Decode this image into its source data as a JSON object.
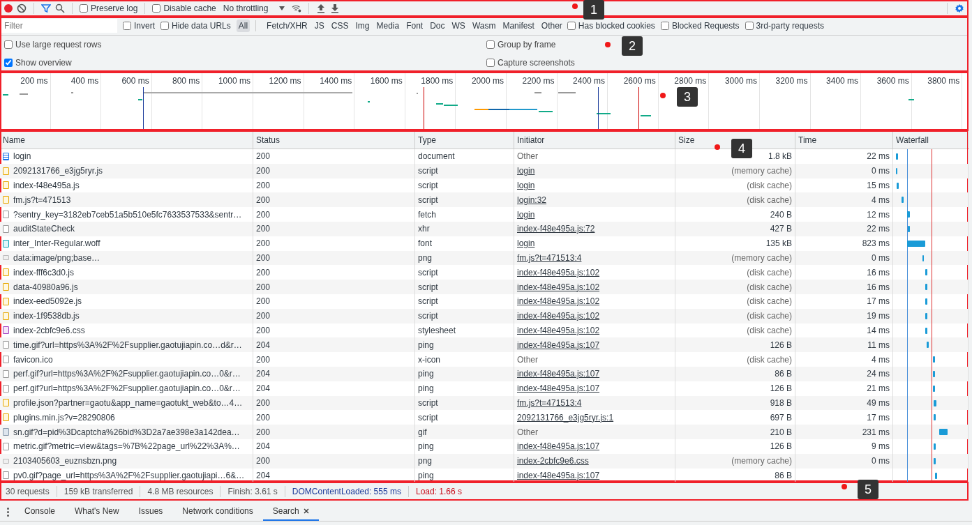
{
  "toolbar": {
    "preserve_log": {
      "label": "Preserve log",
      "checked": false
    },
    "disable_cache": {
      "label": "Disable cache",
      "checked": false
    },
    "throttling": "No throttling",
    "filter_active": true,
    "recording": true
  },
  "filter_bar": {
    "placeholder": "Filter",
    "checks_left": [
      {
        "label": "Invert",
        "checked": false
      },
      {
        "label": "Hide data URLs",
        "checked": false
      }
    ],
    "types": [
      {
        "label": "All",
        "selected": true
      },
      {
        "label": "Fetch/XHR",
        "selected": false
      },
      {
        "label": "JS",
        "selected": false
      },
      {
        "label": "CSS",
        "selected": false
      },
      {
        "label": "Img",
        "selected": false
      },
      {
        "label": "Media",
        "selected": false
      },
      {
        "label": "Font",
        "selected": false
      },
      {
        "label": "Doc",
        "selected": false
      },
      {
        "label": "WS",
        "selected": false
      },
      {
        "label": "Wasm",
        "selected": false
      },
      {
        "label": "Manifest",
        "selected": false
      },
      {
        "label": "Other",
        "selected": false
      }
    ],
    "checks_right": [
      {
        "label": "Has blocked cookies",
        "checked": false
      },
      {
        "label": "Blocked Requests",
        "checked": false
      },
      {
        "label": "3rd-party requests",
        "checked": false
      }
    ]
  },
  "options": [
    [
      {
        "label": "Use large request rows",
        "checked": false
      },
      {
        "label": "Group by frame",
        "checked": false
      }
    ],
    [
      {
        "label": "Show overview",
        "checked": true
      },
      {
        "label": "Capture screenshots",
        "checked": false
      }
    ]
  ],
  "overview": {
    "ticks": [
      "200 ms",
      "400 ms",
      "600 ms",
      "800 ms",
      "1000 ms",
      "1200 ms",
      "1400 ms",
      "1600 ms",
      "1800 ms",
      "2000 ms",
      "2200 ms",
      "2400 ms",
      "2600 ms",
      "2800 ms",
      "3000 ms",
      "3200 ms",
      "3400 ms",
      "3600 ms",
      "3800 ms"
    ]
  },
  "table": {
    "columns": [
      "Name",
      "Status",
      "Type",
      "Initiator",
      "Size",
      "Time",
      "Waterfall"
    ],
    "rows": [
      {
        "kind": "doc",
        "name": "login",
        "status": "200",
        "type": "document",
        "initiator": "Other",
        "initiator_link": false,
        "size": "1.8 kB",
        "cached": false,
        "time": "22 ms"
      },
      {
        "kind": "js",
        "name": "2092131766_e3jg5ryr.js",
        "status": "200",
        "type": "script",
        "initiator": "login",
        "initiator_link": true,
        "size": "(memory cache)",
        "cached": true,
        "time": "0 ms"
      },
      {
        "kind": "js",
        "name": "index-f48e495a.js",
        "status": "200",
        "type": "script",
        "initiator": "login",
        "initiator_link": true,
        "size": "(disk cache)",
        "cached": true,
        "time": "15 ms"
      },
      {
        "kind": "js",
        "name": "fm.js?t=471513",
        "status": "200",
        "type": "script",
        "initiator": "login:32",
        "initiator_link": true,
        "size": "(disk cache)",
        "cached": true,
        "time": "4 ms"
      },
      {
        "kind": "blank",
        "name": "?sentry_key=3182eb7ceb51a5b510e5fc7633537533&sentr…",
        "status": "200",
        "type": "fetch",
        "initiator": "login",
        "initiator_link": true,
        "size": "240 B",
        "cached": false,
        "time": "12 ms"
      },
      {
        "kind": "blank",
        "name": "auditStateCheck",
        "status": "200",
        "type": "xhr",
        "initiator": "index-f48e495a.js:72",
        "initiator_link": true,
        "size": "427 B",
        "cached": false,
        "time": "22 ms"
      },
      {
        "kind": "fnt",
        "name": "inter_Inter-Regular.woff",
        "status": "200",
        "type": "font",
        "initiator": "login",
        "initiator_link": true,
        "size": "135 kB",
        "cached": false,
        "time": "823 ms"
      },
      {
        "kind": "dataimg",
        "name": "data:image/png;base…",
        "status": "200",
        "type": "png",
        "initiator": "fm.js?t=471513:4",
        "initiator_link": true,
        "size": "(memory cache)",
        "cached": true,
        "time": "0 ms"
      },
      {
        "kind": "js",
        "name": "index-fff6c3d0.js",
        "status": "200",
        "type": "script",
        "initiator": "index-f48e495a.js:102",
        "initiator_link": true,
        "size": "(disk cache)",
        "cached": true,
        "time": "16 ms"
      },
      {
        "kind": "js",
        "name": "data-40980a96.js",
        "status": "200",
        "type": "script",
        "initiator": "index-f48e495a.js:102",
        "initiator_link": true,
        "size": "(disk cache)",
        "cached": true,
        "time": "16 ms"
      },
      {
        "kind": "js",
        "name": "index-eed5092e.js",
        "status": "200",
        "type": "script",
        "initiator": "index-f48e495a.js:102",
        "initiator_link": true,
        "size": "(disk cache)",
        "cached": true,
        "time": "17 ms"
      },
      {
        "kind": "js",
        "name": "index-1f9538db.js",
        "status": "200",
        "type": "script",
        "initiator": "index-f48e495a.js:102",
        "initiator_link": true,
        "size": "(disk cache)",
        "cached": true,
        "time": "19 ms"
      },
      {
        "kind": "css",
        "name": "index-2cbfc9e6.css",
        "status": "200",
        "type": "stylesheet",
        "initiator": "index-f48e495a.js:102",
        "initiator_link": true,
        "size": "(disk cache)",
        "cached": true,
        "time": "14 ms"
      },
      {
        "kind": "blank",
        "name": "time.gif?url=https%3A%2F%2Fsupplier.gaotujiapin.co…d&r…",
        "status": "204",
        "type": "ping",
        "initiator": "index-f48e495a.js:107",
        "initiator_link": true,
        "size": "126 B",
        "cached": false,
        "time": "11 ms"
      },
      {
        "kind": "blank",
        "name": "favicon.ico",
        "status": "200",
        "type": "x-icon",
        "initiator": "Other",
        "initiator_link": false,
        "size": "(disk cache)",
        "cached": true,
        "time": "4 ms"
      },
      {
        "kind": "blank",
        "name": "perf.gif?url=https%3A%2F%2Fsupplier.gaotujiapin.co…0&r…",
        "status": "204",
        "type": "ping",
        "initiator": "index-f48e495a.js:107",
        "initiator_link": true,
        "size": "86 B",
        "cached": false,
        "time": "24 ms"
      },
      {
        "kind": "blank",
        "name": "perf.gif?url=https%3A%2F%2Fsupplier.gaotujiapin.co…0&r…",
        "status": "204",
        "type": "ping",
        "initiator": "index-f48e495a.js:107",
        "initiator_link": true,
        "size": "126 B",
        "cached": false,
        "time": "21 ms"
      },
      {
        "kind": "js",
        "name": "profile.json?partner=gaotu&app_name=gaotukt_web&to…4…",
        "status": "200",
        "type": "script",
        "initiator": "fm.js?t=471513:4",
        "initiator_link": true,
        "size": "918 B",
        "cached": false,
        "time": "49 ms"
      },
      {
        "kind": "js",
        "name": "plugins.min.js?v=28290806",
        "status": "200",
        "type": "script",
        "initiator": "2092131766_e3jg5ryr.js:1",
        "initiator_link": true,
        "size": "697 B",
        "cached": false,
        "time": "17 ms"
      },
      {
        "kind": "img",
        "name": "sn.gif?d=pid%3Dcaptcha%26bid%3D2a7ae398e3a142dea…",
        "status": "200",
        "type": "gif",
        "initiator": "Other",
        "initiator_link": false,
        "size": "210 B",
        "cached": false,
        "time": "231 ms"
      },
      {
        "kind": "blank",
        "name": "metric.gif?metric=view&tags=%7B%22page_url%22%3A%…",
        "status": "204",
        "type": "ping",
        "initiator": "index-f48e495a.js:107",
        "initiator_link": true,
        "size": "126 B",
        "cached": false,
        "time": "9 ms"
      },
      {
        "kind": "dataimg",
        "name": "2103405603_euznsbzn.png",
        "status": "200",
        "type": "png",
        "initiator": "index-2cbfc9e6.css",
        "initiator_link": true,
        "size": "(memory cache)",
        "cached": true,
        "time": "0 ms"
      },
      {
        "kind": "blank",
        "name": "pv0.gif?page_url=https%3A%2F%2Fsupplier.gaotujiapi…6&…",
        "status": "204",
        "type": "ping",
        "initiator": "index-f48e495a.js:107",
        "initiator_link": true,
        "size": "86 B",
        "cached": false
      }
    ]
  },
  "status_bar": [
    {
      "kind": "plain",
      "text": "30 requests"
    },
    {
      "kind": "plain",
      "text": "159 kB transferred"
    },
    {
      "kind": "plain",
      "text": "4.8 MB resources"
    },
    {
      "kind": "plain",
      "text": "Finish: 3.61 s"
    },
    {
      "kind": "dcl",
      "text": "DOMContentLoaded: 555 ms"
    },
    {
      "kind": "load",
      "text": "Load: 1.66 s"
    }
  ],
  "drawer_tabs": [
    {
      "label": "Console",
      "selected": false
    },
    {
      "label": "What's New",
      "selected": false
    },
    {
      "label": "Issues",
      "selected": false
    },
    {
      "label": "Network conditions",
      "selected": false
    },
    {
      "label": "Search",
      "selected": true,
      "closable": true
    }
  ],
  "annotations": [
    "1",
    "2",
    "3",
    "4",
    "5"
  ]
}
